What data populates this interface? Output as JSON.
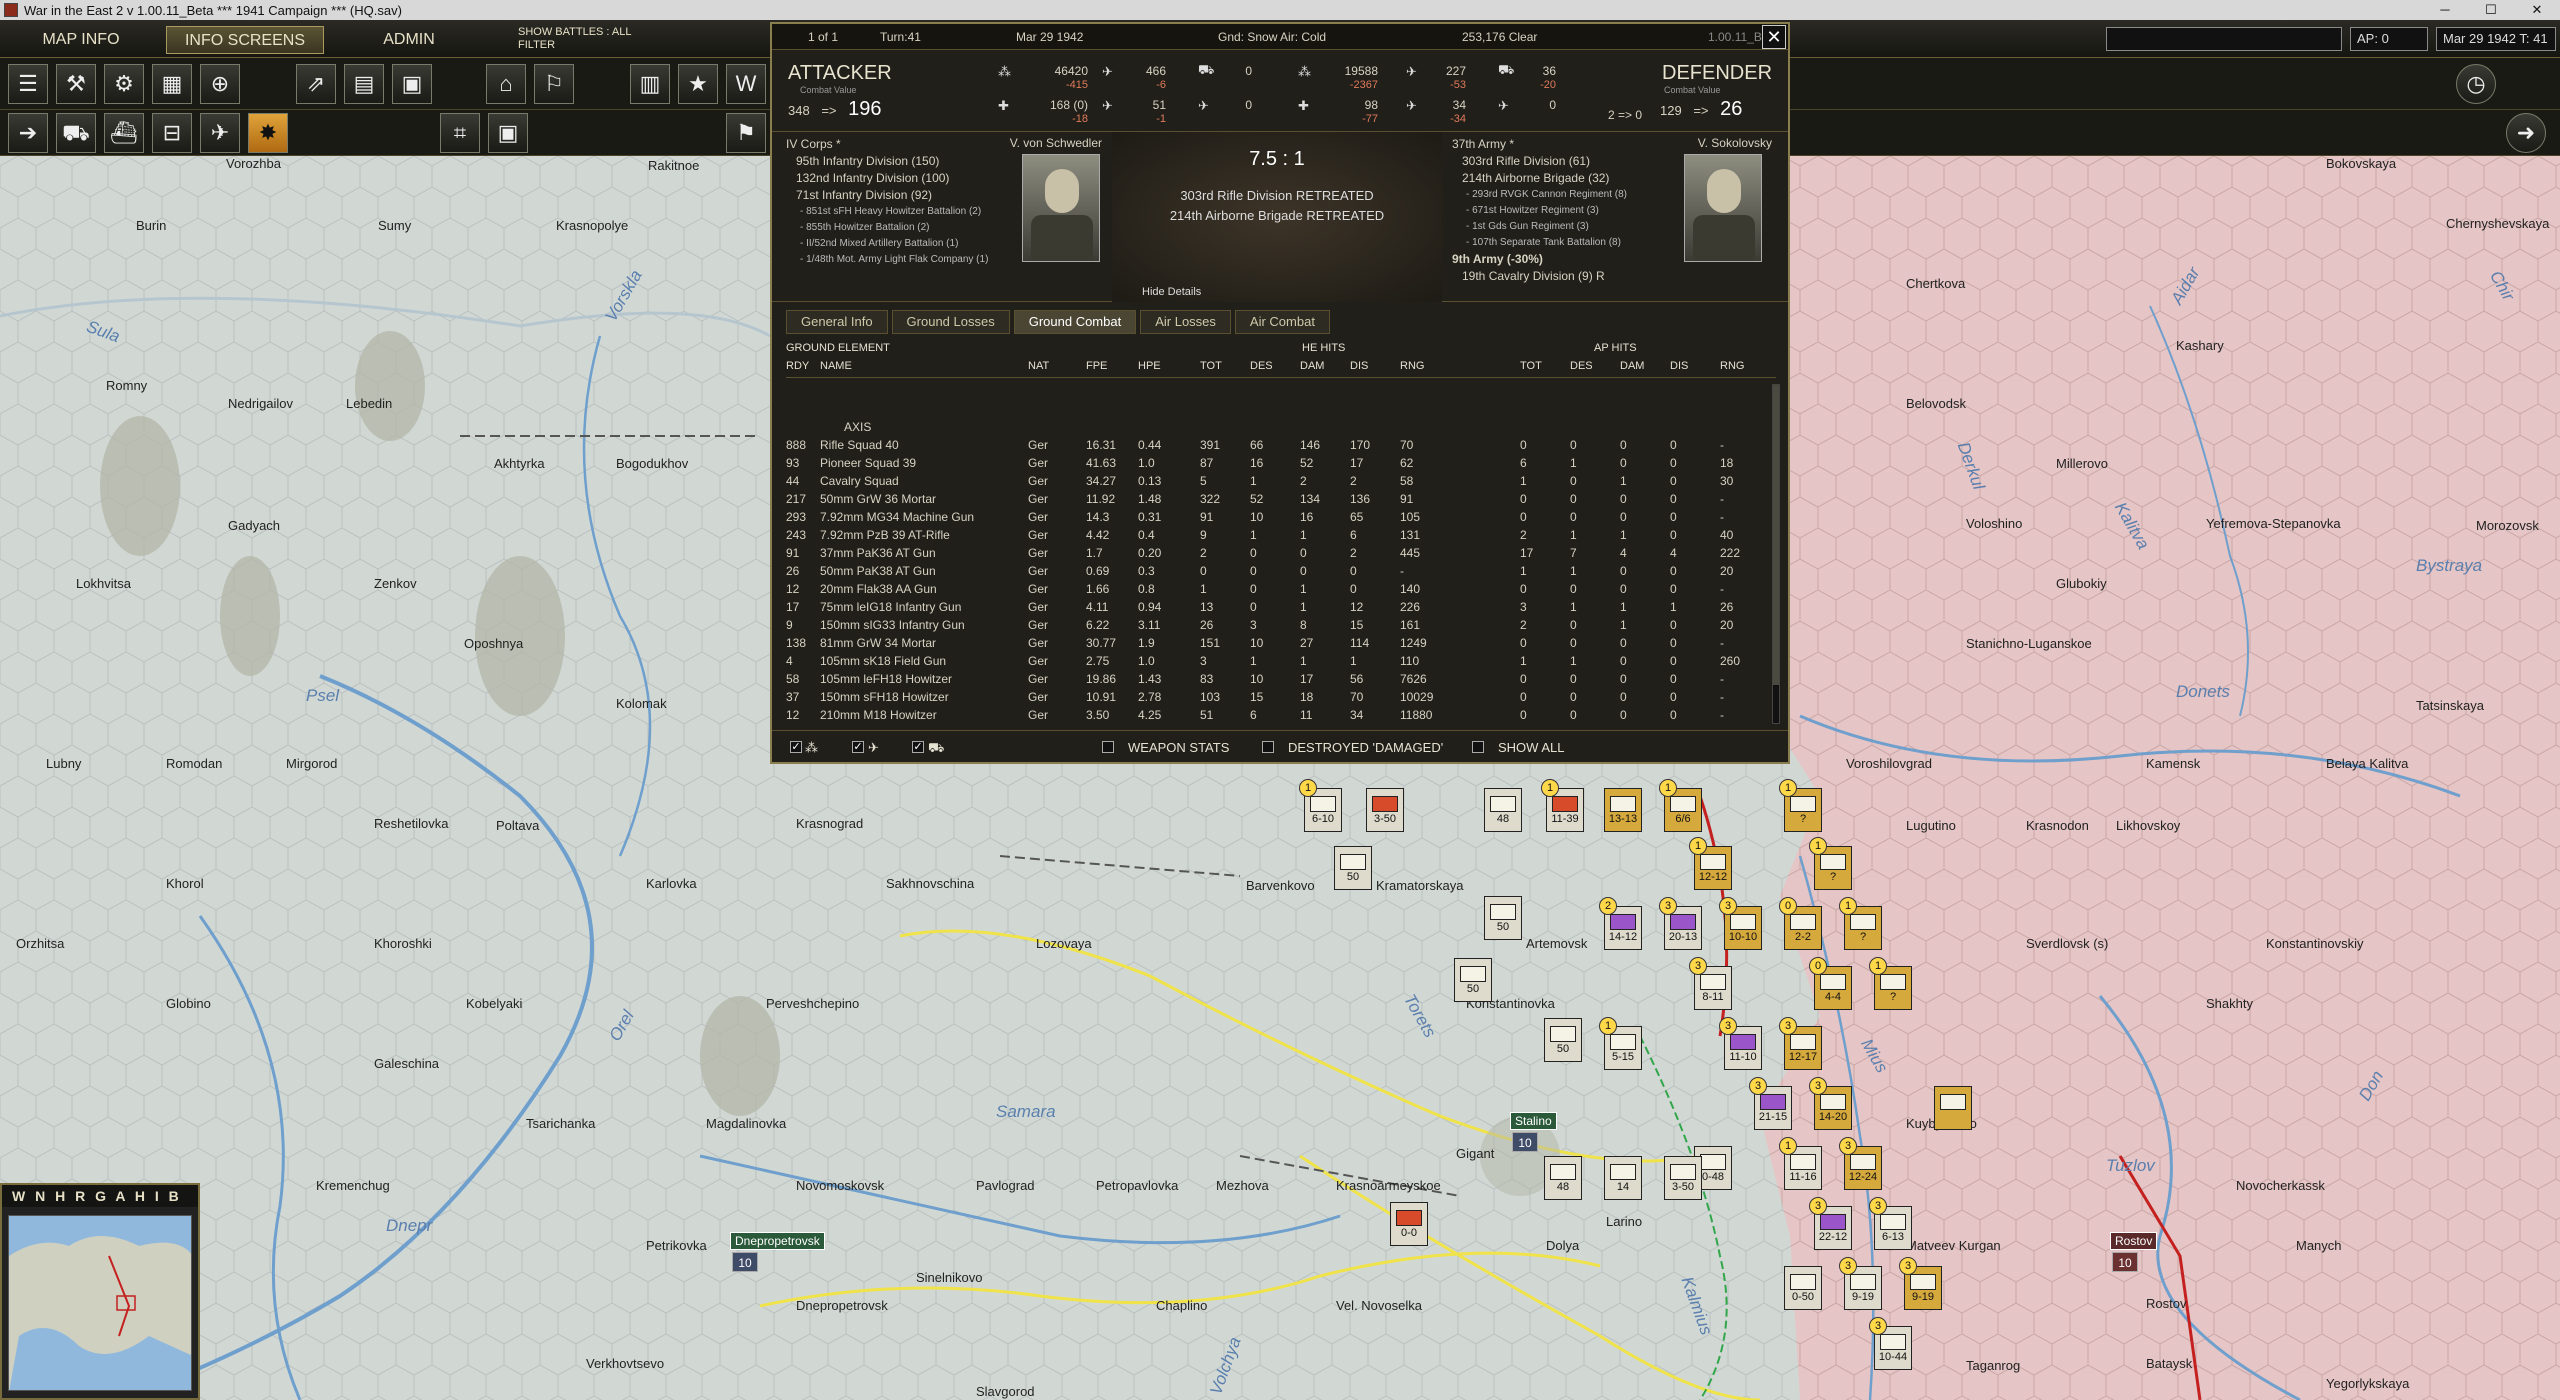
{
  "window": {
    "title": "War in the East 2  v 1.00.11_Beta   ***  1941 Campaign  ***  (HQ.sav)",
    "min": "─",
    "max": "☐",
    "close": "✕"
  },
  "menu": {
    "map_info": "MAP INFO",
    "info_screens": "INFO SCREENS",
    "admin": "ADMIN",
    "show_battles": "SHOW BATTLES : ALL",
    "filter": "FILTER"
  },
  "status": {
    "ap": "AP: 0",
    "date_turn": "Mar 29 1942  T: 41"
  },
  "combat": {
    "header": {
      "page": "1 of 1",
      "turn": "Turn:41",
      "date": "Mar 29 1942",
      "conditions": "Gnd: Snow  Air: Cold",
      "location": "253,176  Clear",
      "version": "1.00.11_Be"
    },
    "attacker": {
      "title": "ATTACKER",
      "cv_label": "Combat Value",
      "cv_before": "348",
      "arrow": "=>",
      "cv_after": "196",
      "men": "46420",
      "men_loss": "-415",
      "guns": "168 (0)",
      "guns_loss": "-18",
      "air": "466",
      "air_loss": "-6",
      "air2": "51",
      "air2_loss": "-1",
      "afv": "0",
      "afv2": "0"
    },
    "defender": {
      "title": "DEFENDER",
      "cv_label": "Combat Value",
      "cv_before": "129",
      "arrow": "=>",
      "cv_after": "26",
      "men": "19588",
      "men_loss": "-2367",
      "guns": "98",
      "guns_loss": "-77",
      "air": "227",
      "air_loss": "-53",
      "air2": "34",
      "air2_loss": "-34",
      "afv": "36",
      "afv_loss": "-20",
      "afv2": "0",
      "ratio": "2 => 0"
    },
    "odds": "7.5 : 1",
    "results": [
      "303rd Rifle Division RETREATED",
      "214th Airborne Brigade RETREATED"
    ],
    "hide_details": "Hide Details",
    "attacker_units": {
      "corps": "IV Corps *",
      "commander": "V. von Schwedler",
      "lines": [
        "95th Infantry Division (150)",
        "132nd Infantry Division (100)",
        "71st Infantry Division (92)"
      ],
      "support": [
        "- 851st sFH Heavy Howitzer Battalion (2)",
        "- 855th Howitzer Battalion (2)",
        "- II/52nd Mixed Artillery Battalion (1)",
        "- 1/48th Mot. Army Light Flak Company (1)"
      ]
    },
    "defender_units": {
      "army": "37th Army *",
      "commander": "V. Sokolovsky",
      "lines": [
        "303rd Rifle Division (61)",
        "214th Airborne Brigade (32)"
      ],
      "support": [
        "- 293rd RVGK Cannon Regiment (8)",
        "- 671st Howitzer Regiment (3)",
        "- 1st Gds Gun Regiment (3)",
        "- 107th Separate Tank Battalion (8)"
      ],
      "army2": "9th Army (-30%)",
      "army2_line": "19th Cavalry Division (9)  R"
    },
    "tabs": [
      "General Info",
      "Ground Losses",
      "Ground Combat",
      "Air Losses",
      "Air Combat"
    ],
    "table": {
      "ground_element": "GROUND ELEMENT",
      "he_hits": "HE HITS",
      "ap_hits": "AP HITS",
      "columns": [
        "RDY",
        "NAME",
        "NAT",
        "FPE",
        "HPE",
        "TOT",
        "DES",
        "DAM",
        "DIS",
        "RNG",
        "TOT",
        "DES",
        "DAM",
        "DIS",
        "RNG"
      ],
      "group": "AXIS",
      "rows": [
        [
          "888",
          "Rifle Squad 40",
          "Ger",
          "16.31",
          "0.44",
          "391",
          "66",
          "146",
          "170",
          "70",
          "0",
          "0",
          "0",
          "0",
          "-"
        ],
        [
          "93",
          "Pioneer Squad 39",
          "Ger",
          "41.63",
          "1.0",
          "87",
          "16",
          "52",
          "17",
          "62",
          "6",
          "1",
          "0",
          "0",
          "18"
        ],
        [
          "44",
          "Cavalry Squad",
          "Ger",
          "34.27",
          "0.13",
          "5",
          "1",
          "2",
          "2",
          "58",
          "1",
          "0",
          "1",
          "0",
          "30"
        ],
        [
          "217",
          "50mm GrW 36 Mortar",
          "Ger",
          "11.92",
          "1.48",
          "322",
          "52",
          "134",
          "136",
          "91",
          "0",
          "0",
          "0",
          "0",
          "-"
        ],
        [
          "293",
          "7.92mm MG34 Machine Gun",
          "Ger",
          "14.3",
          "0.31",
          "91",
          "10",
          "16",
          "65",
          "105",
          "0",
          "0",
          "0",
          "0",
          "-"
        ],
        [
          "243",
          "7.92mm PzB 39 AT-Rifle",
          "Ger",
          "4.42",
          "0.4",
          "9",
          "1",
          "1",
          "6",
          "131",
          "2",
          "1",
          "1",
          "0",
          "40"
        ],
        [
          "91",
          "37mm PaK36 AT Gun",
          "Ger",
          "1.7",
          "0.20",
          "2",
          "0",
          "0",
          "2",
          "445",
          "17",
          "7",
          "4",
          "4",
          "222"
        ],
        [
          "26",
          "50mm PaK38 AT Gun",
          "Ger",
          "0.69",
          "0.3",
          "0",
          "0",
          "0",
          "0",
          "-",
          "1",
          "1",
          "0",
          "0",
          "20"
        ],
        [
          "12",
          "20mm Flak38 AA Gun",
          "Ger",
          "1.66",
          "0.8",
          "1",
          "0",
          "1",
          "0",
          "140",
          "0",
          "0",
          "0",
          "0",
          "-"
        ],
        [
          "17",
          "75mm leIG18 Infantry Gun",
          "Ger",
          "4.11",
          "0.94",
          "13",
          "0",
          "1",
          "12",
          "226",
          "3",
          "1",
          "1",
          "1",
          "26"
        ],
        [
          "9",
          "150mm sIG33 Infantry Gun",
          "Ger",
          "6.22",
          "3.11",
          "26",
          "3",
          "8",
          "15",
          "161",
          "2",
          "0",
          "1",
          "0",
          "20"
        ],
        [
          "138",
          "81mm GrW 34 Mortar",
          "Ger",
          "30.77",
          "1.9",
          "151",
          "10",
          "27",
          "114",
          "1249",
          "0",
          "0",
          "0",
          "0",
          "-"
        ],
        [
          "4",
          "105mm sK18 Field Gun",
          "Ger",
          "2.75",
          "1.0",
          "3",
          "1",
          "1",
          "1",
          "110",
          "1",
          "1",
          "0",
          "0",
          "260"
        ],
        [
          "58",
          "105mm leFH18 Howitzer",
          "Ger",
          "19.86",
          "1.43",
          "83",
          "10",
          "17",
          "56",
          "7626",
          "0",
          "0",
          "0",
          "0",
          "-"
        ],
        [
          "37",
          "150mm sFH18 Howitzer",
          "Ger",
          "10.91",
          "2.78",
          "103",
          "15",
          "18",
          "70",
          "10029",
          "0",
          "0",
          "0",
          "0",
          "-"
        ],
        [
          "12",
          "210mm M18 Howitzer",
          "Ger",
          "3.50",
          "4.25",
          "51",
          "6",
          "11",
          "34",
          "11880",
          "0",
          "0",
          "0",
          "0",
          "-"
        ]
      ]
    },
    "footer": {
      "weapon_stats": "WEAPON STATS",
      "destroyed_damaged": "DESTROYED 'DAMAGED'",
      "show_all": "SHOW ALL"
    }
  },
  "minimap": {
    "tabs": "W N H R G A H I B"
  },
  "map": {
    "cities": [
      [
        "Vorozhba"
      ],
      [
        "Rakitnoe"
      ],
      [
        "Burin"
      ],
      [
        "Sumy"
      ],
      [
        "Krasnopolye"
      ],
      [
        "Romny"
      ],
      [
        "Nedrigailov"
      ],
      [
        "Lebedin"
      ],
      [
        "Akhtyrka"
      ],
      [
        "Bogodukhov"
      ],
      [
        "Gadyach"
      ],
      [
        "Lokhvitsa"
      ],
      [
        "Zenkov"
      ],
      [
        "Oposhnya"
      ],
      [
        "Kolomak"
      ],
      [
        "Lubny"
      ],
      [
        "Romodan"
      ],
      [
        "Mirgorod"
      ],
      [
        "Reshetilovka"
      ],
      [
        "Poltava"
      ],
      [
        "Karlovka"
      ],
      [
        "Khorol"
      ],
      [
        "Orzhitsa"
      ],
      [
        "Khoroshki"
      ],
      [
        "Globino"
      ],
      [
        "Kobelyaki"
      ],
      [
        "Galeschina"
      ],
      [
        "Tsarichanka"
      ],
      [
        "Magdalinovka"
      ],
      [
        "Kremenchug"
      ],
      [
        "Novomoskovsk"
      ],
      [
        "Pavlograd"
      ],
      [
        "Petropavlovka"
      ],
      [
        "Mezhova"
      ],
      [
        "Krasnoarmeyskoe"
      ],
      [
        "Gigant"
      ],
      [
        "Petrikovka"
      ],
      [
        "Dnepropetrovsk"
      ],
      [
        "Sinelnikovo"
      ],
      [
        "Chaplino"
      ],
      [
        "Vel. Novoselka"
      ],
      [
        "Verkhovtsevo"
      ],
      [
        "Slavgorod"
      ],
      [
        "Dolya"
      ],
      [
        "Larino"
      ],
      [
        "Krasnograd"
      ],
      [
        "Sakhnovschina"
      ],
      [
        "Lozovaya"
      ],
      [
        "Perveshchepino"
      ],
      [
        "Barvenkovo"
      ],
      [
        "Kramatorskaya"
      ],
      [
        "Konstantinovka"
      ],
      [
        "Artemovsk"
      ],
      [
        "Voroshilovgrad"
      ],
      [
        "Lugutino"
      ],
      [
        "Krasnodon"
      ],
      [
        "Likhovskoy"
      ],
      [
        "Kamensk"
      ],
      [
        "Belaya Kalitva"
      ],
      [
        "Tatsinskaya"
      ],
      [
        "Sverdlovsk (s)"
      ],
      [
        "Konstantinovskiy"
      ],
      [
        "Shakhty"
      ],
      [
        "Novocherkassk"
      ],
      [
        "Rostov"
      ],
      [
        "Manych"
      ],
      [
        "Taganrog"
      ],
      [
        "Bataysk"
      ],
      [
        "Yegorlykskaya"
      ],
      [
        "Matveev Kurgan"
      ],
      [
        "Kuybyshevo"
      ],
      [
        "Bokovskaya"
      ],
      [
        "Chernyshevskaya"
      ],
      [
        "Chertkova"
      ],
      [
        "Kashary"
      ],
      [
        "Belovodsk"
      ],
      [
        "Millerovo"
      ],
      [
        "Voloshino"
      ],
      [
        "Yefremova-Stepanovka"
      ],
      [
        "Morozovsk"
      ],
      [
        "Glubokiy"
      ],
      [
        "Stanichno-Luganskoe"
      ],
      [
        "Stalino"
      ],
      [
        "Dnepropetrovsk"
      ],
      [
        "Rostov"
      ]
    ],
    "rivers": [
      "Psel",
      "Vorskla",
      "Sula",
      "Dnepr",
      "Samara",
      "Orel",
      "Donets",
      "Don",
      "Mius",
      "Kalmius",
      "Torets",
      "Volchya",
      "Tuzlov",
      "Derkul",
      "Bystraya",
      "Kalitva",
      "Aidar",
      "Chir"
    ],
    "badges": {
      "stalino": "Stalino",
      "dnepr": "Dnepropetrovsk",
      "rostov": "Rostov",
      "vp": "10"
    }
  }
}
